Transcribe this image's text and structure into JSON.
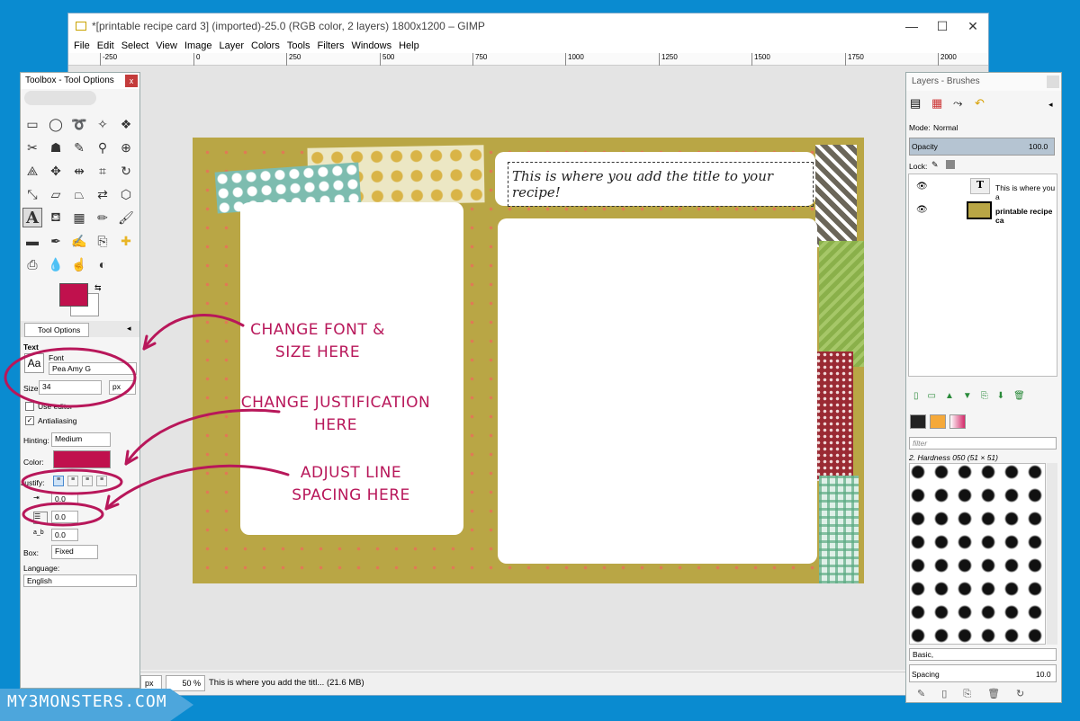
{
  "window": {
    "title": "*[printable recipe card 3] (imported)-25.0 (RGB color, 2 layers) 1800x1200 – GIMP",
    "min_glyph": "—",
    "max_glyph": "☐",
    "close_glyph": "✕"
  },
  "menu": [
    "File",
    "Edit",
    "Select",
    "View",
    "Image",
    "Layer",
    "Colors",
    "Tools",
    "Filters",
    "Windows",
    "Help"
  ],
  "ruler_ticks": [
    "-250",
    "0",
    "250",
    "500",
    "750",
    "1000",
    "1250",
    "1500",
    "1750",
    "2000"
  ],
  "status": {
    "unit": "px",
    "zoom": "50 %",
    "message": "This is where you add the titl... (21.6 MB)"
  },
  "card": {
    "title_text": "This is where you add the title to your recipe!"
  },
  "toolbox": {
    "title": "Toolbox - Tool Options",
    "close": "x",
    "tab_label": "Tool Options",
    "section": "Text",
    "font_label": "Font",
    "font_value": "Pea Amy G",
    "size_label": "Size:",
    "size_value": "34",
    "size_unit": "px",
    "use_editor": "Use editor",
    "antialiasing": "Antialiasing",
    "hinting_label": "Hinting:",
    "hinting_value": "Medium",
    "color_label": "Color:",
    "justify_label": "Justify:",
    "indent_value": "0.0",
    "line_spacing_value": "0.0",
    "letter_spacing_value": "0.0",
    "box_label": "Box:",
    "box_value": "Fixed",
    "language_label": "Language:",
    "language_value": "English",
    "fg_color": "#c0114d"
  },
  "layers": {
    "title": "Layers - Brushes",
    "mode_label": "Mode:",
    "mode_value": "Normal",
    "opacity_label": "Opacity",
    "opacity_value": "100.0",
    "lock_label": "Lock:",
    "items": [
      {
        "name": "This is where you a"
      },
      {
        "name": "printable recipe ca"
      }
    ],
    "filter_placeholder": "filter",
    "brush_name": "2. Hardness 050 (51 × 51)",
    "preset": "Basic,",
    "spacing_label": "Spacing",
    "spacing_value": "10.0"
  },
  "annotations": {
    "font": "CHANGE FONT & SIZE HERE",
    "justify": "CHANGE JUSTIFICATION HERE",
    "spacing": "ADJUST LINE SPACING HERE"
  },
  "watermark": "MY3MONSTERS.COM",
  "colors": {
    "annotation": "#b8175a",
    "card_bg": "#b9a645",
    "dots": "#e07a55"
  }
}
